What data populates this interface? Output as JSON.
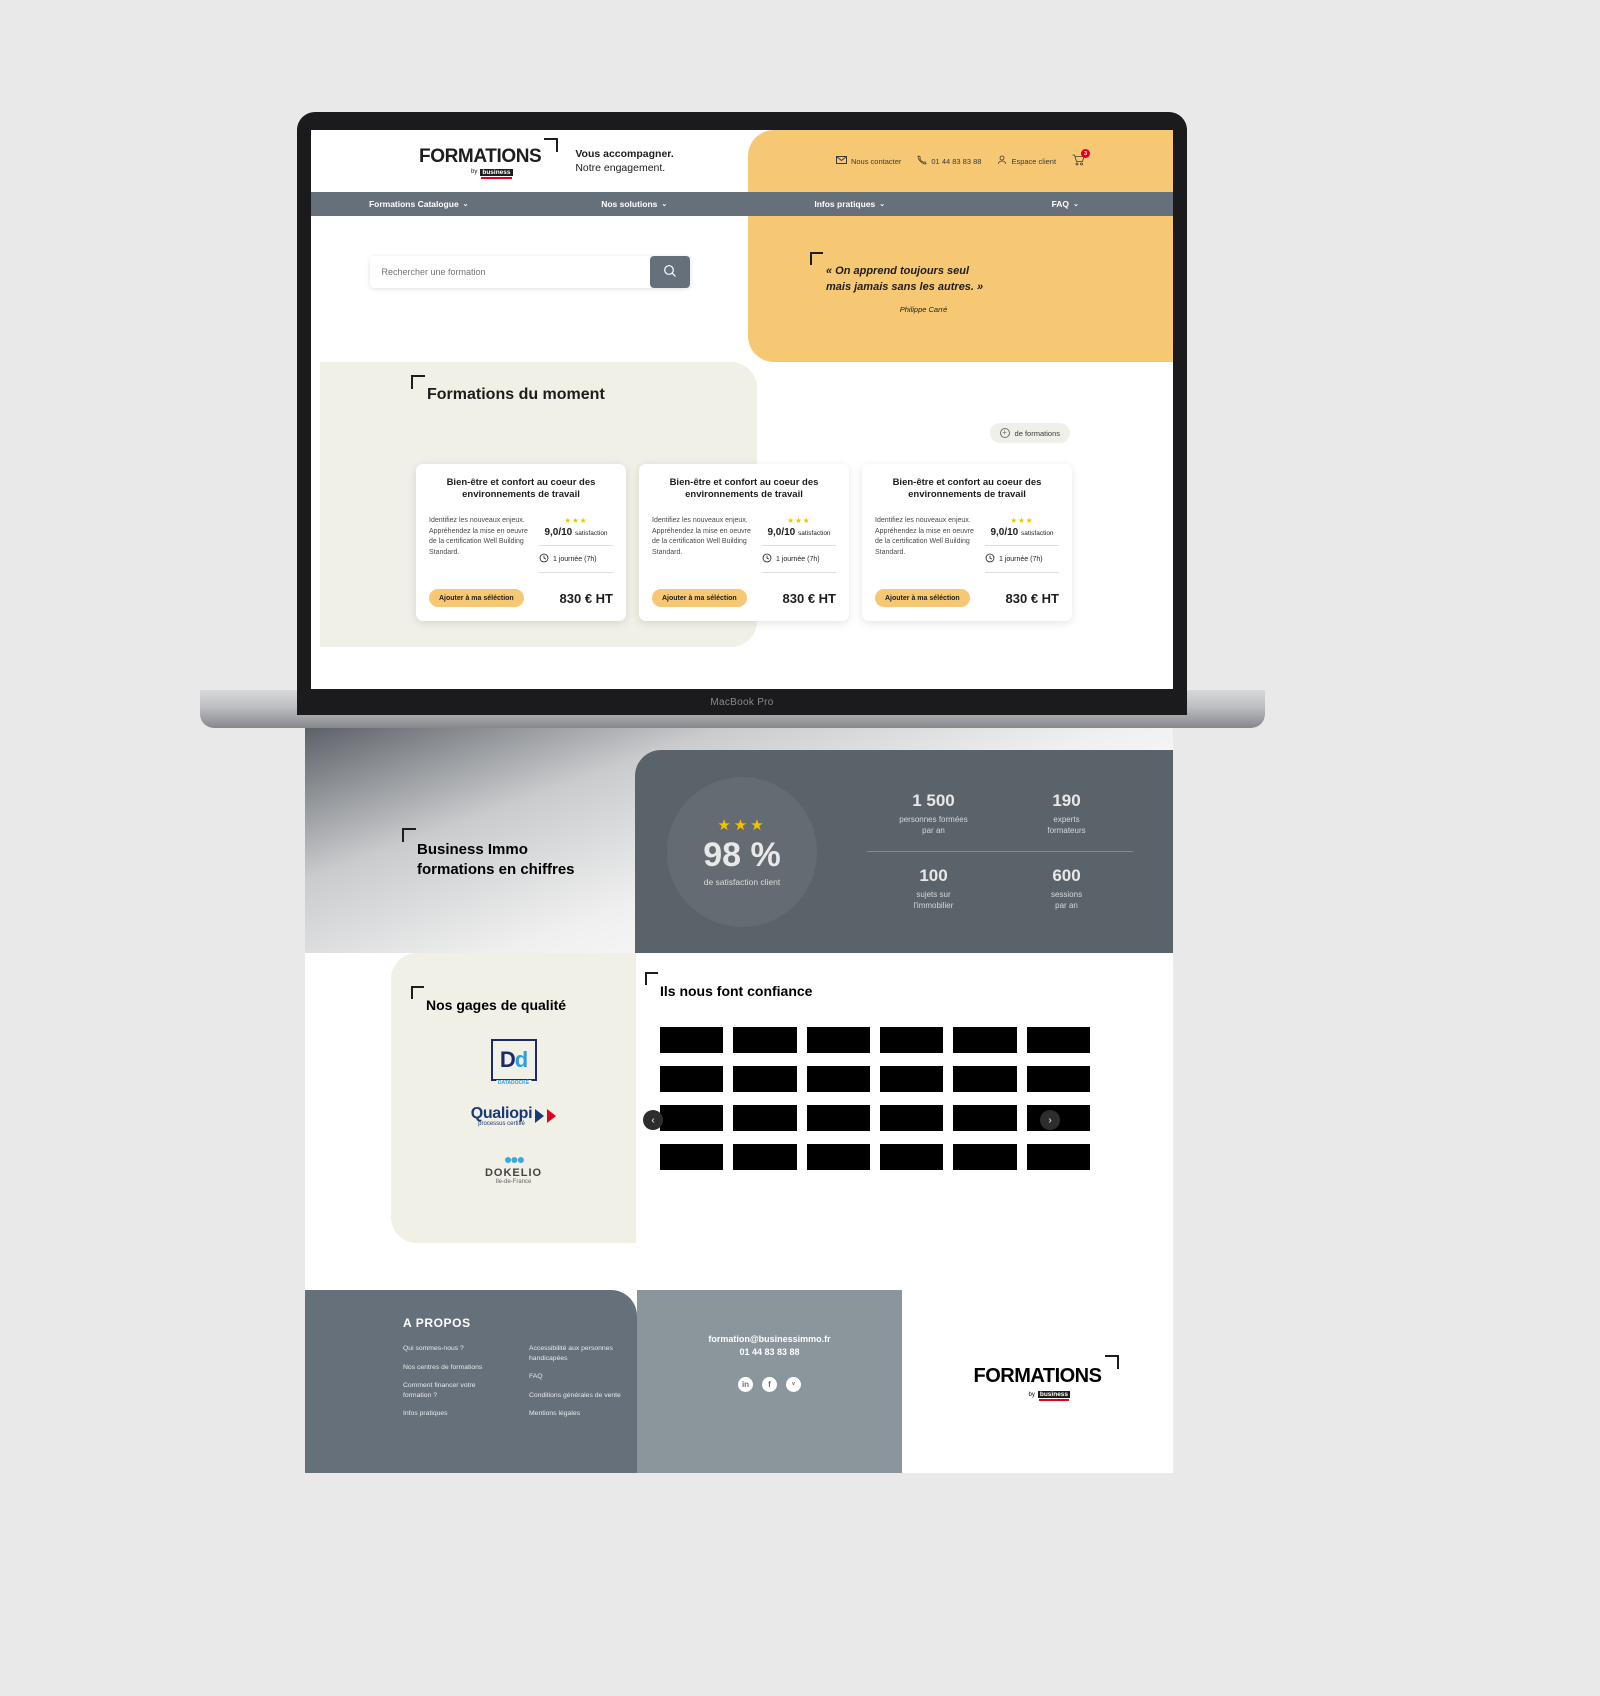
{
  "device": {
    "name": "MacBook Pro"
  },
  "header": {
    "logo_main": "FORMATIONS",
    "logo_by": "by",
    "logo_brand": "business",
    "tagline_line1": "Vous accompagner.",
    "tagline_line2": "Notre engagement.",
    "utils": [
      {
        "icon": "envelope-icon",
        "label": "Nous contacter"
      },
      {
        "icon": "phone-icon",
        "label": "01 44 83 83 88"
      },
      {
        "icon": "user-icon",
        "label": "Espace client"
      }
    ],
    "cart_count": "3"
  },
  "nav": {
    "items": [
      {
        "label": "Formations Catalogue",
        "caret": "⌄"
      },
      {
        "label": "Nos solutions",
        "caret": "⌄"
      },
      {
        "label": "Infos pratiques",
        "caret": "⌄"
      },
      {
        "label": "FAQ",
        "caret": "⌄"
      }
    ]
  },
  "search": {
    "placeholder": "Rechercher une formation",
    "value": "",
    "button_icon": "search-icon"
  },
  "quote": {
    "text": "« On apprend toujours seul mais jamais sans les autres. »",
    "line1": "« On apprend toujours seul",
    "line2": "mais jamais sans les autres. »",
    "author": "Philippe Carré"
  },
  "moment": {
    "title": "Formations du moment",
    "more_label": "de formations",
    "more_icon": "plus-circle-icon",
    "cards": [
      {
        "title": "Bien-être et confort au coeur des environnements de travail",
        "description": "Identifiez les nouveaux enjeux. Appréhendez la mise en oeuvre de la certification Well Building Standard.",
        "stars": "★★★",
        "rating": "9,0/10",
        "rating_label": "satisfaction",
        "duration": "1 journée (7h)",
        "duration_icon": "clock-icon",
        "add_label": "Ajouter à ma séléction",
        "price": "830 € HT"
      },
      {
        "title": "Bien-être et confort au coeur des environnements de travail",
        "description": "Identifiez les nouveaux enjeux. Appréhendez la mise en oeuvre de la certification Well Building Standard.",
        "stars": "★★★",
        "rating": "9,0/10",
        "rating_label": "satisfaction",
        "duration": "1 journée (7h)",
        "duration_icon": "clock-icon",
        "add_label": "Ajouter à ma séléction",
        "price": "830 € HT"
      },
      {
        "title": "Bien-être et confort au coeur des environnements de travail",
        "description": "Identifiez les nouveaux enjeux. Appréhendez la mise en oeuvre de la certification Well Building Standard.",
        "stars": "★★★",
        "rating": "9,0/10",
        "rating_label": "satisfaction",
        "duration": "1 journée (7h)",
        "duration_icon": "clock-icon",
        "add_label": "Ajouter à ma séléction",
        "price": "830 € HT"
      }
    ]
  },
  "stats": {
    "heading_line1": "Business Immo",
    "heading_line2": "formations en chiffres",
    "circle": {
      "stars": "★★★",
      "percent": "98 %",
      "label": "de satisfaction client"
    },
    "items": [
      {
        "number": "1 500",
        "label_line1": "personnes formées",
        "label_line2": "par an"
      },
      {
        "number": "190",
        "label_line1": "experts",
        "label_line2": "formateurs"
      },
      {
        "number": "100",
        "label_line1": "sujets sur",
        "label_line2": "l'immobilier"
      },
      {
        "number": "600",
        "label_line1": "sessions",
        "label_line2": "par an"
      }
    ]
  },
  "quality": {
    "title": "Nos gages de qualité",
    "badges": [
      {
        "name": "datadock-badge",
        "main": "Dd",
        "sub": "DATADOCKÉ"
      },
      {
        "name": "qualiopi-badge",
        "main": "Qualiopi",
        "sub": "processus certifié"
      },
      {
        "name": "dokelio-badge",
        "main": "DOKELIO",
        "sub": "Ile-de-France"
      }
    ]
  },
  "trust": {
    "title": "Ils nous font confiance",
    "logo_count": 24,
    "prev_icon": "chevron-left-icon",
    "next_icon": "chevron-right-icon"
  },
  "footer": {
    "about_title": "A PROPOS",
    "links_col1": [
      "Qui sommes-nous ?",
      "Nos centres de formations",
      "Comment financer votre formation ?",
      "Infos pratiques"
    ],
    "links_col2": [
      "Accessibilité aux personnes handicapées",
      "FAQ",
      "Conditions générales de vente",
      "Mentions légales"
    ],
    "email": "formation@businessimmo.fr",
    "phone": "01 44 83 83 88",
    "socials": [
      {
        "name": "linkedin-icon",
        "glyph": "in"
      },
      {
        "name": "facebook-icon",
        "glyph": "f"
      },
      {
        "name": "twitter-icon",
        "glyph": "ᵛ"
      }
    ],
    "logo_main": "FORMATIONS",
    "logo_by": "by",
    "logo_brand": "business"
  },
  "colors": {
    "accent": "#f7c873",
    "slate": "#66707a",
    "dark_slate": "#5b636a",
    "cream": "#f0f0e6",
    "star": "#f2c200",
    "badge_red": "#e2001a"
  }
}
